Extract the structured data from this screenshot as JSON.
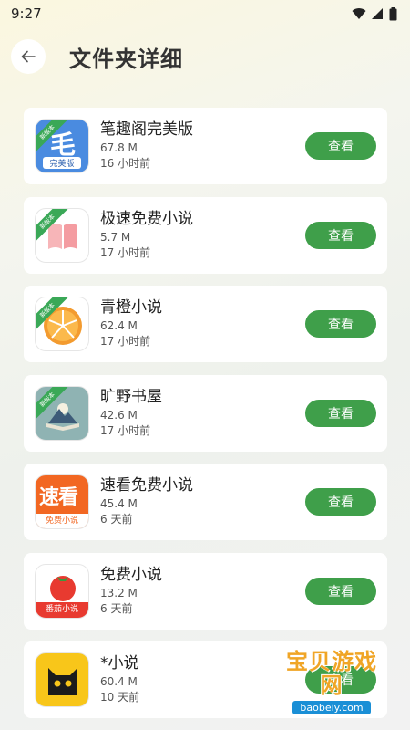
{
  "status": {
    "time": "9:27"
  },
  "header": {
    "title": "文件夹详细"
  },
  "ribbon_label": "新版本",
  "view_label": "查看",
  "apps": [
    {
      "name": "笔趣阁完美版",
      "size": "67.8 M",
      "time": "16 小时前",
      "icon_text": "完美版",
      "icon_glyph": "毛"
    },
    {
      "name": "极速免费小说",
      "size": "5.7 M",
      "time": "17 小时前"
    },
    {
      "name": "青橙小说",
      "size": "62.4 M",
      "time": "17 小时前"
    },
    {
      "name": "旷野书屋",
      "size": "42.6 M",
      "time": "17 小时前"
    },
    {
      "name": "速看免费小说",
      "size": "45.4 M",
      "time": "6 天前",
      "icon_glyph": "速看",
      "icon_text": "免费小说"
    },
    {
      "name": "免费小说",
      "size": "13.2 M",
      "time": "6 天前",
      "icon_text": "番茄小说"
    },
    {
      "name": "*小说",
      "size": "60.4 M",
      "time": "10 天前"
    }
  ],
  "watermark": {
    "text": "宝贝游戏网",
    "url": "baobeiy.com"
  }
}
